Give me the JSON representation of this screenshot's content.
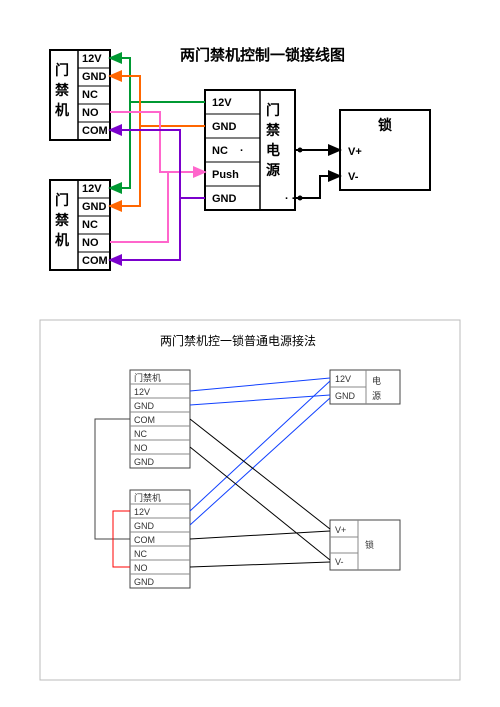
{
  "diagram_top": {
    "title": "两门禁机控制一锁接线图",
    "reader_label_vertical": "门禁机",
    "power_label_vertical": "门禁电源",
    "lock_label": "锁",
    "reader_pins": [
      "12V",
      "GND",
      "NC",
      "NO",
      "COM"
    ],
    "power_pins": [
      "12V",
      "GND",
      "NC",
      "Push",
      "GND"
    ],
    "lock_pins": [
      "V+",
      "V-"
    ],
    "wire_colors": {
      "12V": "#009933",
      "GND": "#ff6600",
      "NC": "#000000",
      "NO": "#ff66cc",
      "COM": "#7a00cc"
    }
  },
  "diagram_bottom": {
    "title": "两门禁机控一锁普通电源接法",
    "reader_label": "门禁机",
    "power_label_right": "电源",
    "lock_label": "锁",
    "reader_pins": [
      "12V",
      "GND",
      "COM",
      "NC",
      "NO",
      "GND"
    ],
    "power_pins": [
      "12V",
      "GND"
    ],
    "lock_pins": [
      "V+",
      "V-"
    ]
  },
  "purpose": "Wiring diagrams showing how two access-control readers connect to one lock via an access-control power supply (top) and via an ordinary power supply (bottom).",
  "chart_data": [
    {
      "type": "table",
      "title": "两门禁机控制一锁接线图",
      "note": "Connections between two readers, one access-control PSU, and one lock",
      "rows": [
        {
          "from": "Reader1.12V",
          "to": "PSU.12V",
          "color": "green"
        },
        {
          "from": "Reader1.GND",
          "to": "PSU.GND",
          "color": "orange"
        },
        {
          "from": "Reader1.NO",
          "to": "PSU.Push",
          "color": "pink"
        },
        {
          "from": "Reader1.COM",
          "to": "PSU.GND(bottom)",
          "color": "purple"
        },
        {
          "from": "Reader2.12V",
          "to": "PSU.12V",
          "color": "green"
        },
        {
          "from": "Reader2.GND",
          "to": "PSU.GND",
          "color": "orange"
        },
        {
          "from": "Reader2.NO",
          "to": "PSU.Push",
          "color": "pink"
        },
        {
          "from": "Reader2.COM",
          "to": "PSU.GND(bottom)",
          "color": "purple"
        },
        {
          "from": "PSU.NC",
          "to": "Lock.V+",
          "color": "black"
        },
        {
          "from": "PSU.GND(bottom)",
          "to": "Lock.V-",
          "color": "black"
        }
      ]
    },
    {
      "type": "table",
      "title": "两门禁机控一锁普通电源接法",
      "note": "Connections between two readers, ordinary PSU, and one lock",
      "rows": [
        {
          "from": "Reader1.12V",
          "to": "PSU.12V",
          "color": "blue"
        },
        {
          "from": "Reader1.GND",
          "to": "PSU.GND",
          "color": "blue"
        },
        {
          "from": "Reader2.12V",
          "to": "PSU.12V",
          "color": "blue"
        },
        {
          "from": "Reader2.GND",
          "to": "PSU.GND",
          "color": "blue"
        },
        {
          "from": "Reader1.COM",
          "to": "Lock.V+",
          "color": "black"
        },
        {
          "from": "Reader2.COM",
          "to": "Lock.V+",
          "color": "black"
        },
        {
          "from": "Reader1.NO",
          "to": "Lock.V-",
          "color": "black"
        },
        {
          "from": "Reader2.NO",
          "to": "Lock.V-",
          "color": "black"
        },
        {
          "from": "Reader2.12V",
          "to": "Reader2.NO",
          "color": "red",
          "note": "jumper"
        }
      ]
    }
  ]
}
